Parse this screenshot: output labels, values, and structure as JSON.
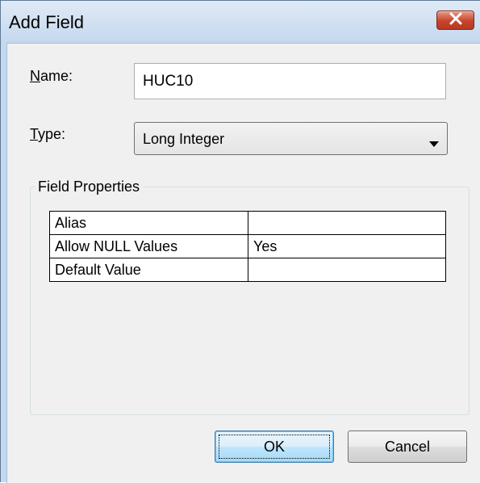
{
  "window": {
    "title": "Add Field"
  },
  "name_field": {
    "label_mnemonic": "N",
    "label_rest": "ame:",
    "value": "HUC10"
  },
  "type_field": {
    "label_mnemonic": "T",
    "label_rest": "ype:",
    "selected": "Long Integer"
  },
  "field_properties": {
    "group_title": "Field Properties",
    "rows": [
      {
        "name": "Alias",
        "value": ""
      },
      {
        "name": "Allow NULL Values",
        "value": "Yes"
      },
      {
        "name": "Default Value",
        "value": ""
      }
    ]
  },
  "buttons": {
    "ok_label": "OK",
    "cancel_label": "Cancel"
  },
  "colors": {
    "title_bar": "#c4d8ed",
    "close_button": "#c7432b",
    "client_background": "#f0f0f0",
    "default_button_border": "#3c7fb1"
  },
  "icons": {
    "close": "close-icon",
    "dropdown": "chevron-down-icon"
  }
}
